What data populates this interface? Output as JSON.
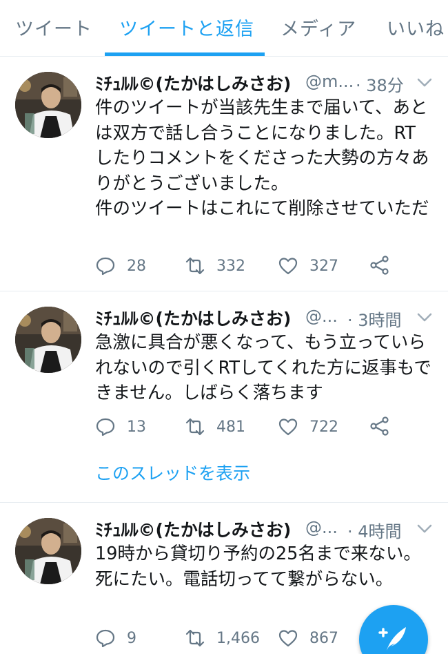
{
  "tabs": [
    {
      "label": "ツイート"
    },
    {
      "label": "ツイートと返信"
    },
    {
      "label": "メディア"
    },
    {
      "label": "いいね"
    }
  ],
  "colors": {
    "accent": "#1da1f2",
    "muted": "#657786",
    "text": "#14171a",
    "divider": "#e6ecf0"
  },
  "tweets": [
    {
      "name": "ﾐﾁｭﾙﾙ©(たかはしみさお)",
      "handle": "@m...",
      "time": "· 38分",
      "text": "件のツイートが当該先生まで届いて、あとは双方で話し合うことになりました。RTしたりコメントをくださった大勢の方々ありがとうございました。\n件のツイートはこれにて削除させていただきます。",
      "replies": "28",
      "retweets": "332",
      "likes": "327"
    },
    {
      "name": "ﾐﾁｭﾙﾙ©(たかはしみさお)",
      "handle": "@...",
      "time": "· 3時間",
      "text": "急激に具合が悪くなって、もう立っていられないので引くRTしてくれた方に返事もできません。しばらく落ちます",
      "replies": "13",
      "retweets": "481",
      "likes": "722",
      "thread_link": "このスレッドを表示"
    },
    {
      "name": "ﾐﾁｭﾙﾙ©(たかはしみさお)",
      "handle": "@...",
      "time": "· 4時間",
      "text": "19時から貸切り予約の25名まで来ない。死にたい。電話切ってて繋がらない。",
      "replies": "9",
      "retweets": "1,466",
      "likes": "867"
    }
  ],
  "icons": {
    "reply": "reply-icon",
    "retweet": "retweet-icon",
    "like": "heart-icon",
    "share": "share-icon",
    "more": "chevron-down-icon",
    "compose": "compose-tweet-icon"
  }
}
